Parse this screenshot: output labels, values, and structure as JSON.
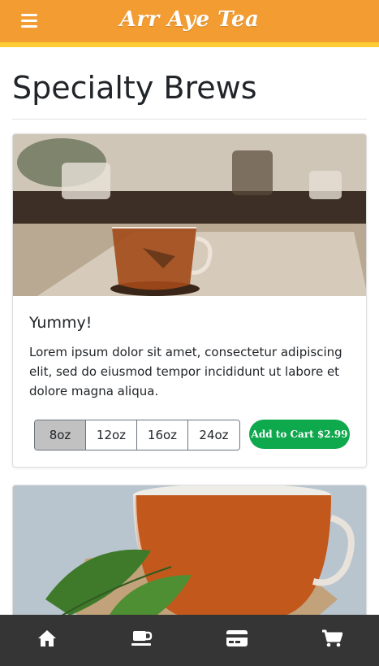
{
  "header": {
    "brand": "Arr Aye Tea",
    "menu_icon": "hamburger-menu-icon",
    "bar_color": "#f39c32",
    "accent_color": "#ffcc33"
  },
  "page": {
    "title": "Specialty Brews"
  },
  "cards": [
    {
      "image_icon": "tea-cup-photo",
      "title": "Yummy!",
      "text": "Lorem ipsum dolor sit amet, consectetur adipiscing elit, sed do eiusmod tempor incididunt ut labore et dolore magna aliqua.",
      "sizes": [
        "8oz",
        "12oz",
        "16oz",
        "24oz"
      ],
      "selected_size": "8oz",
      "cart_label": "Add to Cart $2.99",
      "cart_color": "#0ea84d"
    },
    {
      "image_icon": "tea-cup-with-mint-photo"
    }
  ],
  "bottom_nav": [
    {
      "icon": "home-icon"
    },
    {
      "icon": "coffee-cup-icon"
    },
    {
      "icon": "credit-card-icon"
    },
    {
      "icon": "shopping-cart-icon"
    }
  ]
}
